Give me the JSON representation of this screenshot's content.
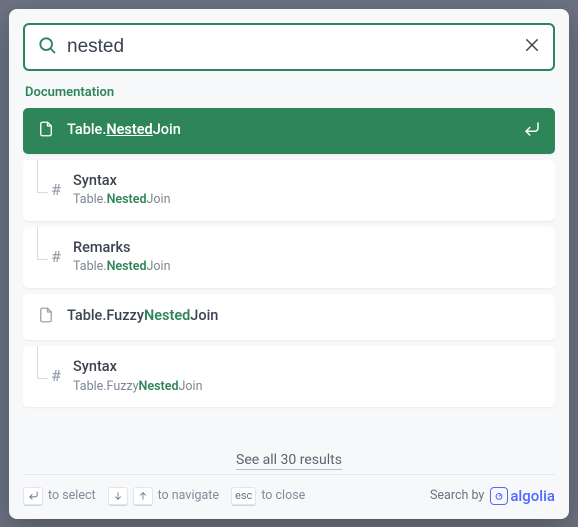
{
  "search": {
    "value": "nested",
    "placeholder": "Search"
  },
  "section_label": "Documentation",
  "results": [
    {
      "selected": true,
      "kind": "page",
      "title_parts": [
        "Table.",
        "Nested",
        "Join"
      ]
    },
    {
      "kind": "anchor",
      "title": "Syntax",
      "crumb_parts": [
        "Table.",
        "Nested",
        "Join"
      ]
    },
    {
      "kind": "anchor",
      "title": "Remarks",
      "crumb_parts": [
        "Table.",
        "Nested",
        "Join"
      ]
    },
    {
      "kind": "page",
      "title_parts": [
        "Table.Fuzzy",
        "Nested",
        "Join"
      ]
    },
    {
      "kind": "anchor",
      "title": "Syntax",
      "crumb_parts": [
        "Table.Fuzzy",
        "Nested",
        "Join"
      ]
    }
  ],
  "see_all": "See all 30 results",
  "footer": {
    "select": "to select",
    "navigate": "to navigate",
    "close": "to close",
    "esc": "esc",
    "search_by": "Search by",
    "provider": "algolia"
  }
}
